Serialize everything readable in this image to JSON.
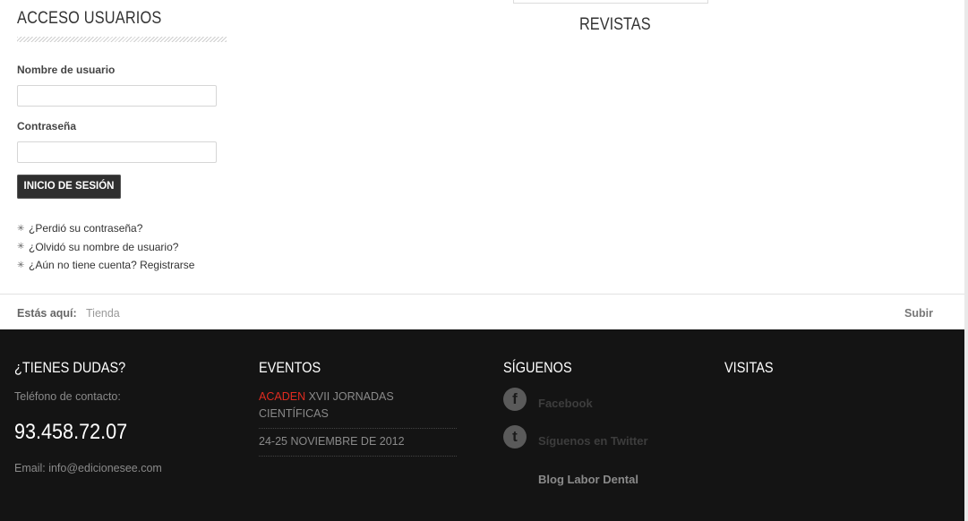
{
  "login": {
    "title": "ACCESO USUARIOS",
    "username_label": "Nombre de usuario",
    "username_value": "",
    "password_label": "Contraseña",
    "password_value": "",
    "submit_label": "INICIO DE SESIÓN",
    "links": [
      {
        "label": "¿Perdió su contraseña?"
      },
      {
        "label": "¿Olvidó su nombre de usuario?"
      },
      {
        "label": "¿Aún no tiene cuenta? Registrarse"
      }
    ]
  },
  "revistas": {
    "title": "REVISTAS"
  },
  "breadcrumb": {
    "label": "Estás aquí:",
    "item": "Tienda",
    "up_label": "Subir"
  },
  "footer": {
    "contact": {
      "heading": "¿TIENES DUDAS?",
      "phone_label": "Teléfono de contacto:",
      "phone": "93.458.72.07",
      "email": "Email: info@edicionesee.com"
    },
    "events": {
      "heading": "EVENTOS",
      "highlight": "ACADEN",
      "title_rest": " XVII JORNADAS CIENTÍFICAS",
      "date": "24-25 NOVIEMBRE DE 2012"
    },
    "follow": {
      "heading": "SÍGUENOS",
      "facebook_label": "Facebook",
      "facebook_icon": "f",
      "twitter_label": "Síguenos en Twitter",
      "twitter_icon": "t",
      "blog_label": "Blog Labor Dental"
    },
    "visits": {
      "heading": "VISITAS"
    }
  },
  "colors": {
    "footer_bg": "#141414",
    "accent_red": "#e02b20",
    "button_bg": "#2f2f2f"
  }
}
